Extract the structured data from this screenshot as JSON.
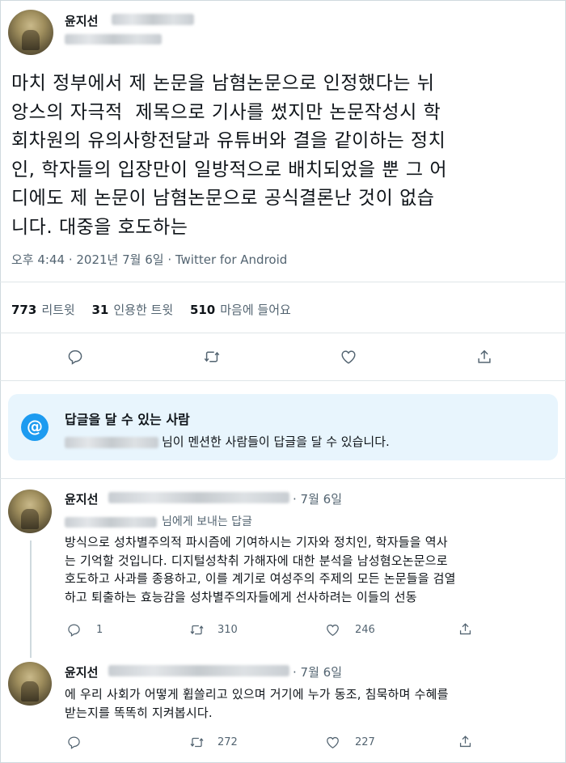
{
  "tweet": {
    "author": "윤지선",
    "text_lines": [
      "마치 정부에서 제 논문을 남혐논문으로 인정했다는 뉘",
      "앙스의 자극적  제목으로 기사를 썼지만 논문작성시 학",
      "회차원의 유의사항전달과 유튜버와 결을 같이하는 정치",
      "인, 학자들의 입장만이 일방적으로 배치되었을 뿐 그 어",
      "디에도 제 논문이 남혐논문으로 공식결론난 것이 없습",
      "니다. 대중을 호도하는"
    ],
    "meta": "오후 4:44 · 2021년 7월 6일 · Twitter for Android",
    "stats": {
      "retweets_count": "773",
      "retweets_label": "리트윗",
      "quotes_count": "31",
      "quotes_label": "인용한 트윗",
      "likes_count": "510",
      "likes_label": "마음에 들어요"
    }
  },
  "reply_notice": {
    "title": "답글을 달 수 있는 사람",
    "desc": "님이 멘션한 사람들이 답글을 달 수 있습니다.",
    "icon": "at-icon"
  },
  "replies": [
    {
      "author": "윤지선",
      "time": "· 7월 6일",
      "replying_to": "님에게 보내는 답글",
      "lines": [
        "방식으로 성차별주의적 파시즘에 기여하시는 기자와 정치인, 학자들을 역사",
        "는 기억할 것입니다. 디지털성착취 가해자에 대한 분석을 남성혐오논문으로",
        "호도하고 사과를 종용하고, 이를 계기로 여성주의 주제의 모든 논문들을 검열",
        "하고 퇴출하는 효능감을 성차별주의자들에게 선사하려는 이들의 선동"
      ],
      "reply_count": "1",
      "retweet_count": "310",
      "like_count": "246"
    },
    {
      "author": "윤지선",
      "time": "· 7월 6일",
      "lines": [
        "에 우리 사회가 어떻게 휩쓸리고 있으며 거기에 누가 동조, 침묵하며 수혜를",
        "받는지를 똑똑히 지켜봅시다."
      ],
      "reply_count": "",
      "retweet_count": "272",
      "like_count": "227"
    }
  ],
  "colors": {
    "accent": "#1d9bf0",
    "secondary_text": "#536471",
    "notice_bg": "#e8f5fd"
  }
}
